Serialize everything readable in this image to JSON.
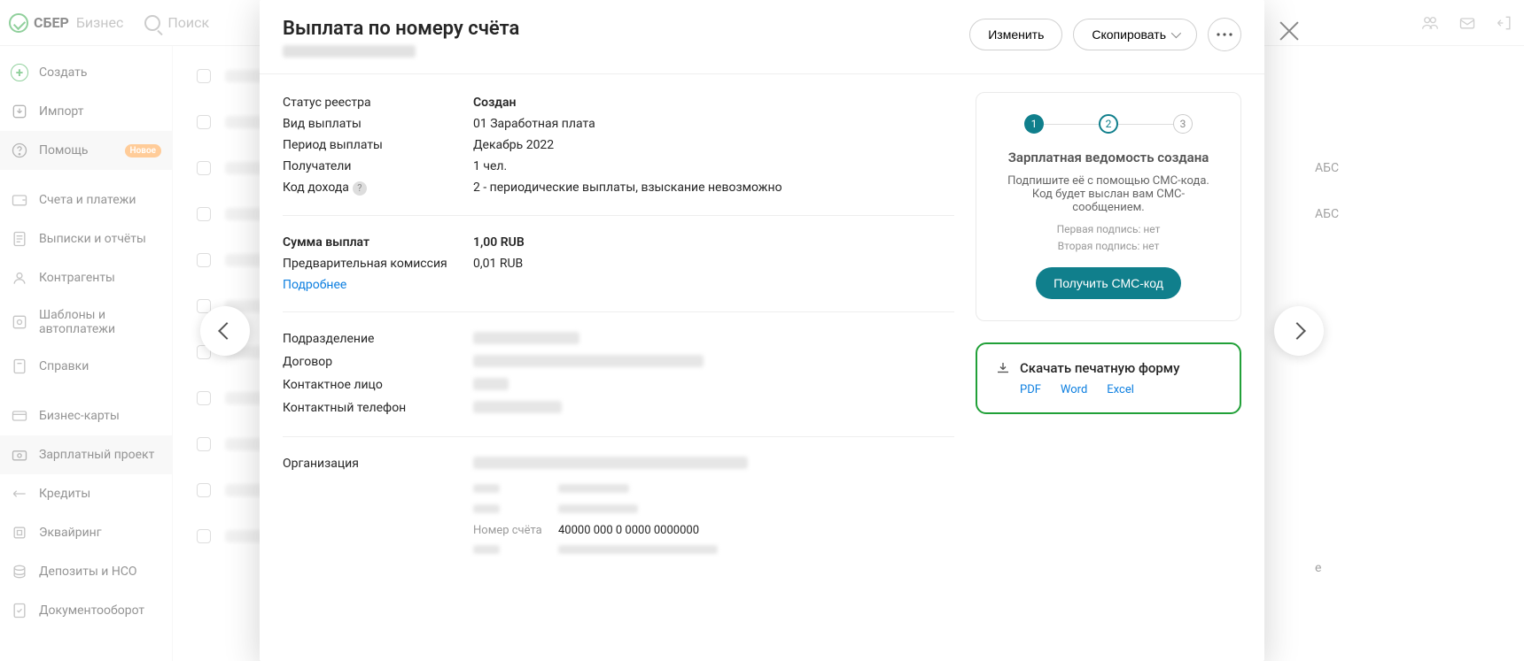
{
  "header": {
    "brand_main": "СБЕР",
    "brand_sub": "Бизнес",
    "search_placeholder": "Поиск"
  },
  "sidebar": {
    "create": "Создать",
    "import": "Импорт",
    "help": "Помощь",
    "help_badge": "Новое",
    "items": [
      "Счета и платежи",
      "Выписки и отчёты",
      "Контрагенты",
      "Шаблоны и автоплатежи",
      "Справки",
      "Бизнес-карты",
      "Зарплатный проект",
      "Кредиты",
      "Эквайринг",
      "Депозиты и НСО",
      "Документооборот"
    ]
  },
  "bg_right": {
    "t1": "АБС",
    "t2": "АБС",
    "t3": "e"
  },
  "modal": {
    "title": "Выплата по номеру счёта",
    "actions": {
      "edit": "Изменить",
      "copy": "Скопировать"
    },
    "block1": {
      "status_k": "Статус реестра",
      "status_v": "Создан",
      "type_k": "Вид выплаты",
      "type_v": "01 Заработная плата",
      "period_k": "Период выплаты",
      "period_v": "Декабрь 2022",
      "recip_k": "Получатели",
      "recip_v": "1 чел.",
      "inc_k": "Код дохода",
      "inc_v": "2 - периодические выплаты, взыскание невозможно"
    },
    "block2": {
      "sum_k": "Сумма выплат",
      "sum_v": "1,00 RUB",
      "fee_k": "Предварительная комиссия",
      "fee_v": "0,01 RUB",
      "more": "Подробнее"
    },
    "block3": {
      "unit_k": "Подразделение",
      "contract_k": "Договор",
      "contact_k": "Контактное лицо",
      "phone_k": "Контактный телефон"
    },
    "block4": {
      "org_k": "Организация",
      "acct_k": "Номер счёта",
      "acct_v": "40000 000 0 0000 0000000"
    },
    "status": {
      "step1": "1",
      "step2": "2",
      "step3": "3",
      "title": "Зарплатная ведомость создана",
      "desc": "Подпишите её с помощью СМС-кода. Код будет выслан вам СМС-сообщением.",
      "sign1": "Первая подпись: нет",
      "sign2": "Вторая подпись: нет",
      "btn": "Получить СМС-код"
    },
    "download": {
      "title": "Скачать печатную форму",
      "pdf": "PDF",
      "word": "Word",
      "excel": "Excel"
    }
  }
}
